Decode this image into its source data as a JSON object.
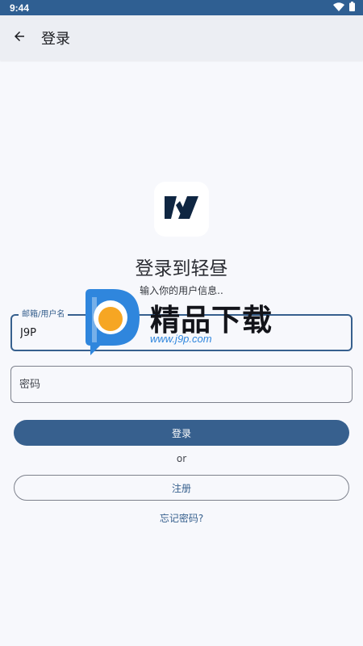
{
  "status_bar": {
    "time": "9:44",
    "icons": [
      "wifi-icon",
      "battery-icon"
    ]
  },
  "app_bar": {
    "title": "登录",
    "back_icon": "arrow-left-icon"
  },
  "logo": {
    "icon": "app-logo"
  },
  "login": {
    "heading": "登录到轻昼",
    "subheading": "输入你的用户信息..",
    "email_label": "邮箱/用户名",
    "email_value": "J9P",
    "password_placeholder": "密码",
    "login_button": "登录",
    "or_text": "or",
    "register_button": "注册",
    "forgot_link": "忘记密码?"
  },
  "watermark": {
    "text": "精品下载",
    "url": "www.j9p.com"
  },
  "colors": {
    "primary": "#37608e",
    "status_bar": "#2f5f92",
    "background": "#f7f8fc",
    "app_bar": "#eceef3",
    "watermark_blue": "#2f86dd",
    "watermark_orange": "#f6a623"
  }
}
